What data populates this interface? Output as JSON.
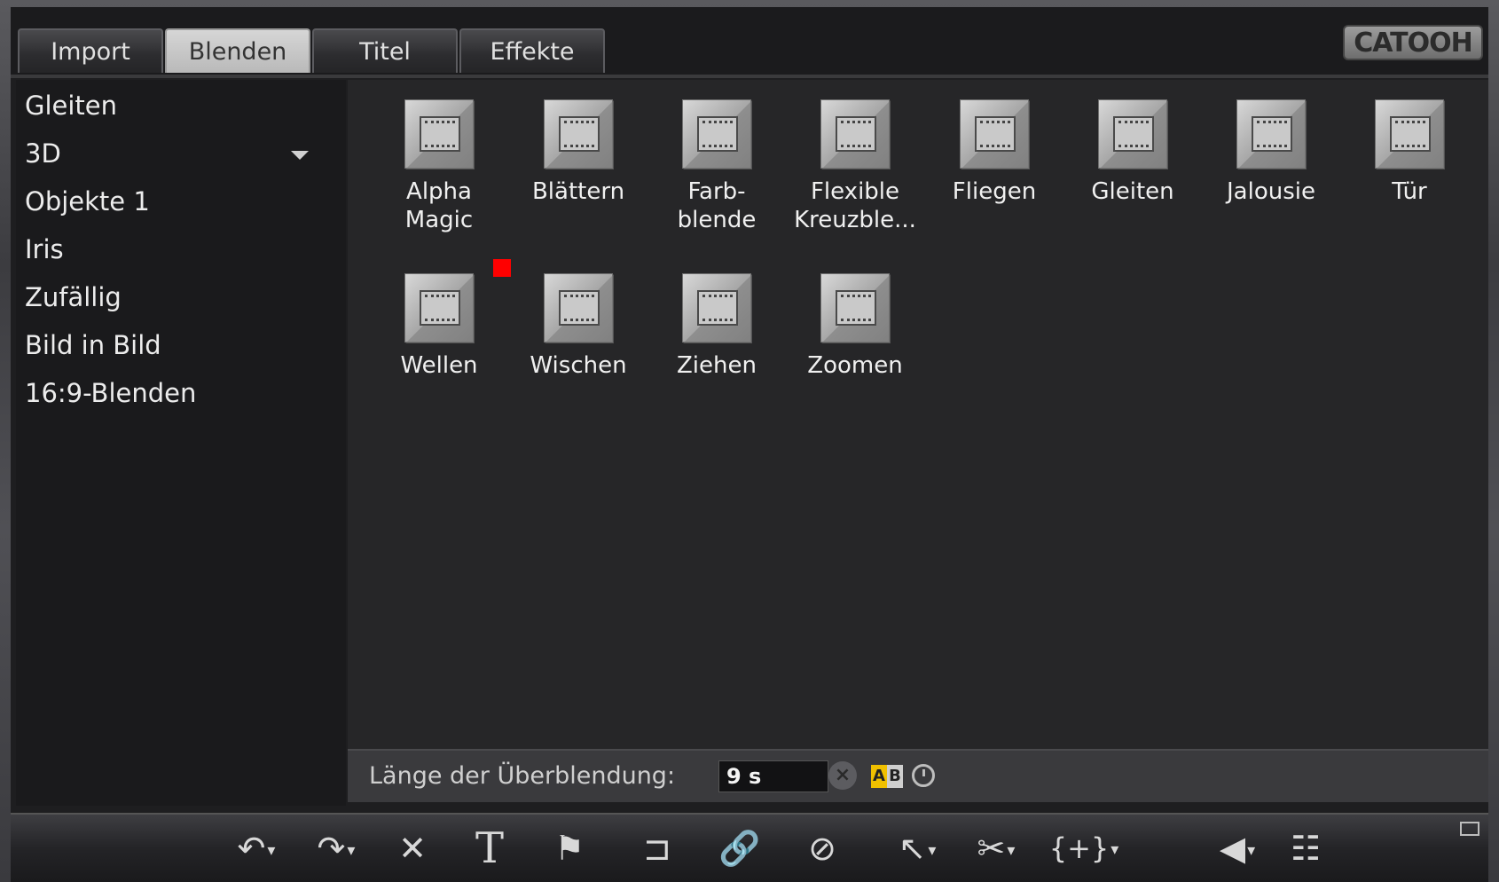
{
  "tabs": [
    {
      "label": "Import",
      "active": false
    },
    {
      "label": "Blenden",
      "active": true
    },
    {
      "label": "Titel",
      "active": false
    },
    {
      "label": "Effekte",
      "active": false
    }
  ],
  "logo": "CATOOH",
  "categories": [
    {
      "label": "Gleiten"
    },
    {
      "label": "3D",
      "expandable": true
    },
    {
      "label": "Objekte 1"
    },
    {
      "label": "Iris"
    },
    {
      "label": "Zufällig"
    },
    {
      "label": "Bild in Bild"
    },
    {
      "label": "16:9-Blenden"
    }
  ],
  "transitions": [
    {
      "label": "Alpha\nMagic"
    },
    {
      "label": "Blättern"
    },
    {
      "label": "Farb-\nblende"
    },
    {
      "label": "Flexible\nKreuzble..."
    },
    {
      "label": "Fliegen"
    },
    {
      "label": "Gleiten"
    },
    {
      "label": "Jalousie"
    },
    {
      "label": "Tür"
    },
    {
      "label": "Wellen"
    },
    {
      "label": "Wischen"
    },
    {
      "label": "Ziehen"
    },
    {
      "label": "Zoomen"
    }
  ],
  "footer": {
    "duration_label": "Länge der Überblendung:",
    "duration_value": "9 s",
    "ab_a": "A",
    "ab_b": "B"
  },
  "toolbar": {
    "icons": [
      "undo-icon",
      "redo-icon",
      "delete-icon",
      "text-icon",
      "marker-flag-icon",
      "snap-icon",
      "link-icon",
      "unlink-icon",
      "pointer-mode-icon",
      "razor-icon",
      "insert-mode-icon",
      "audio-icon",
      "mixer-icon"
    ],
    "undo": "↶",
    "redo": "↷",
    "delete": "✕",
    "text": "T",
    "flag": "⚑",
    "snap": "⊐",
    "link": "🔗",
    "unlink": "⊘",
    "pointer": "↖",
    "razor": "✂",
    "insert": "{+}",
    "audio": "◀",
    "mixer": "☷",
    "dropdown": "▾"
  },
  "colors": {
    "marker": "#ff0000",
    "ab_a_bg": "#f0c000"
  }
}
